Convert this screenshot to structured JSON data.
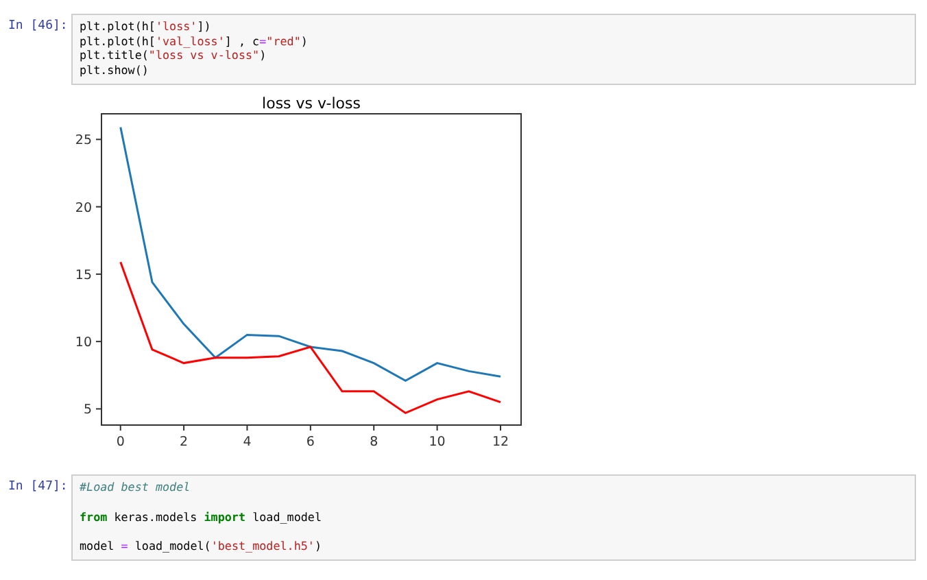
{
  "cells": [
    {
      "prompt": "In [46]:",
      "blocks": [
        {
          "lines": [
            {
              "tokens": [
                {
                  "kind": "plain",
                  "text": "plt.plot(h["
                },
                {
                  "kind": "string",
                  "text": "'loss'"
                },
                {
                  "kind": "plain",
                  "text": "])"
                }
              ]
            },
            {
              "tokens": [
                {
                  "kind": "plain",
                  "text": "plt.plot(h["
                },
                {
                  "kind": "string",
                  "text": "'val_loss'"
                },
                {
                  "kind": "plain",
                  "text": "] , c"
                },
                {
                  "kind": "operator",
                  "text": "="
                },
                {
                  "kind": "string",
                  "text": "\"red\""
                },
                {
                  "kind": "plain",
                  "text": ")"
                }
              ]
            },
            {
              "tokens": [
                {
                  "kind": "plain",
                  "text": "plt.title("
                },
                {
                  "kind": "string",
                  "text": "\"loss vs v-loss\""
                },
                {
                  "kind": "plain",
                  "text": ")"
                }
              ]
            },
            {
              "tokens": [
                {
                  "kind": "plain",
                  "text": "plt.show()"
                }
              ]
            }
          ]
        }
      ],
      "output": {
        "chart_data": {
          "type": "line",
          "title": "loss vs v-loss",
          "x": [
            0,
            1,
            2,
            3,
            4,
            5,
            6,
            7,
            8,
            9,
            10,
            11,
            12
          ],
          "series": [
            {
              "color": "#1f77b4",
              "values": [
                25.9,
                14.4,
                11.3,
                8.8,
                10.5,
                10.4,
                9.6,
                9.3,
                8.4,
                7.1,
                8.4,
                7.8,
                7.4
              ]
            },
            {
              "color": "#ff0000",
              "values": [
                15.9,
                9.4,
                8.4,
                8.8,
                8.8,
                8.9,
                9.6,
                6.3,
                6.3,
                4.7,
                5.7,
                6.3,
                5.5
              ]
            }
          ],
          "xlim": [
            -0.6,
            12.65
          ],
          "ylim": [
            3.8,
            26.9
          ],
          "xticks": [
            0,
            2,
            4,
            6,
            8,
            10,
            12
          ],
          "yticks": [
            5,
            10,
            15,
            20,
            25
          ]
        }
      }
    },
    {
      "prompt": "In [47]:",
      "blocks": [
        {
          "lines": [
            {
              "tokens": [
                {
                  "kind": "comment",
                  "text": "#Load best model"
                }
              ]
            }
          ]
        },
        {
          "lines": [
            {
              "tokens": [
                {
                  "kind": "keyword",
                  "text": "from"
                },
                {
                  "kind": "plain",
                  "text": " keras.models "
                },
                {
                  "kind": "keyword",
                  "text": "import"
                },
                {
                  "kind": "plain",
                  "text": " load_model"
                }
              ]
            }
          ]
        },
        {
          "lines": [
            {
              "tokens": [
                {
                  "kind": "plain",
                  "text": "model "
                },
                {
                  "kind": "operator",
                  "text": "="
                },
                {
                  "kind": "plain",
                  "text": " load_model("
                },
                {
                  "kind": "string",
                  "text": "'best_model.h5'"
                },
                {
                  "kind": "plain",
                  "text": ")"
                }
              ]
            }
          ]
        }
      ]
    }
  ]
}
